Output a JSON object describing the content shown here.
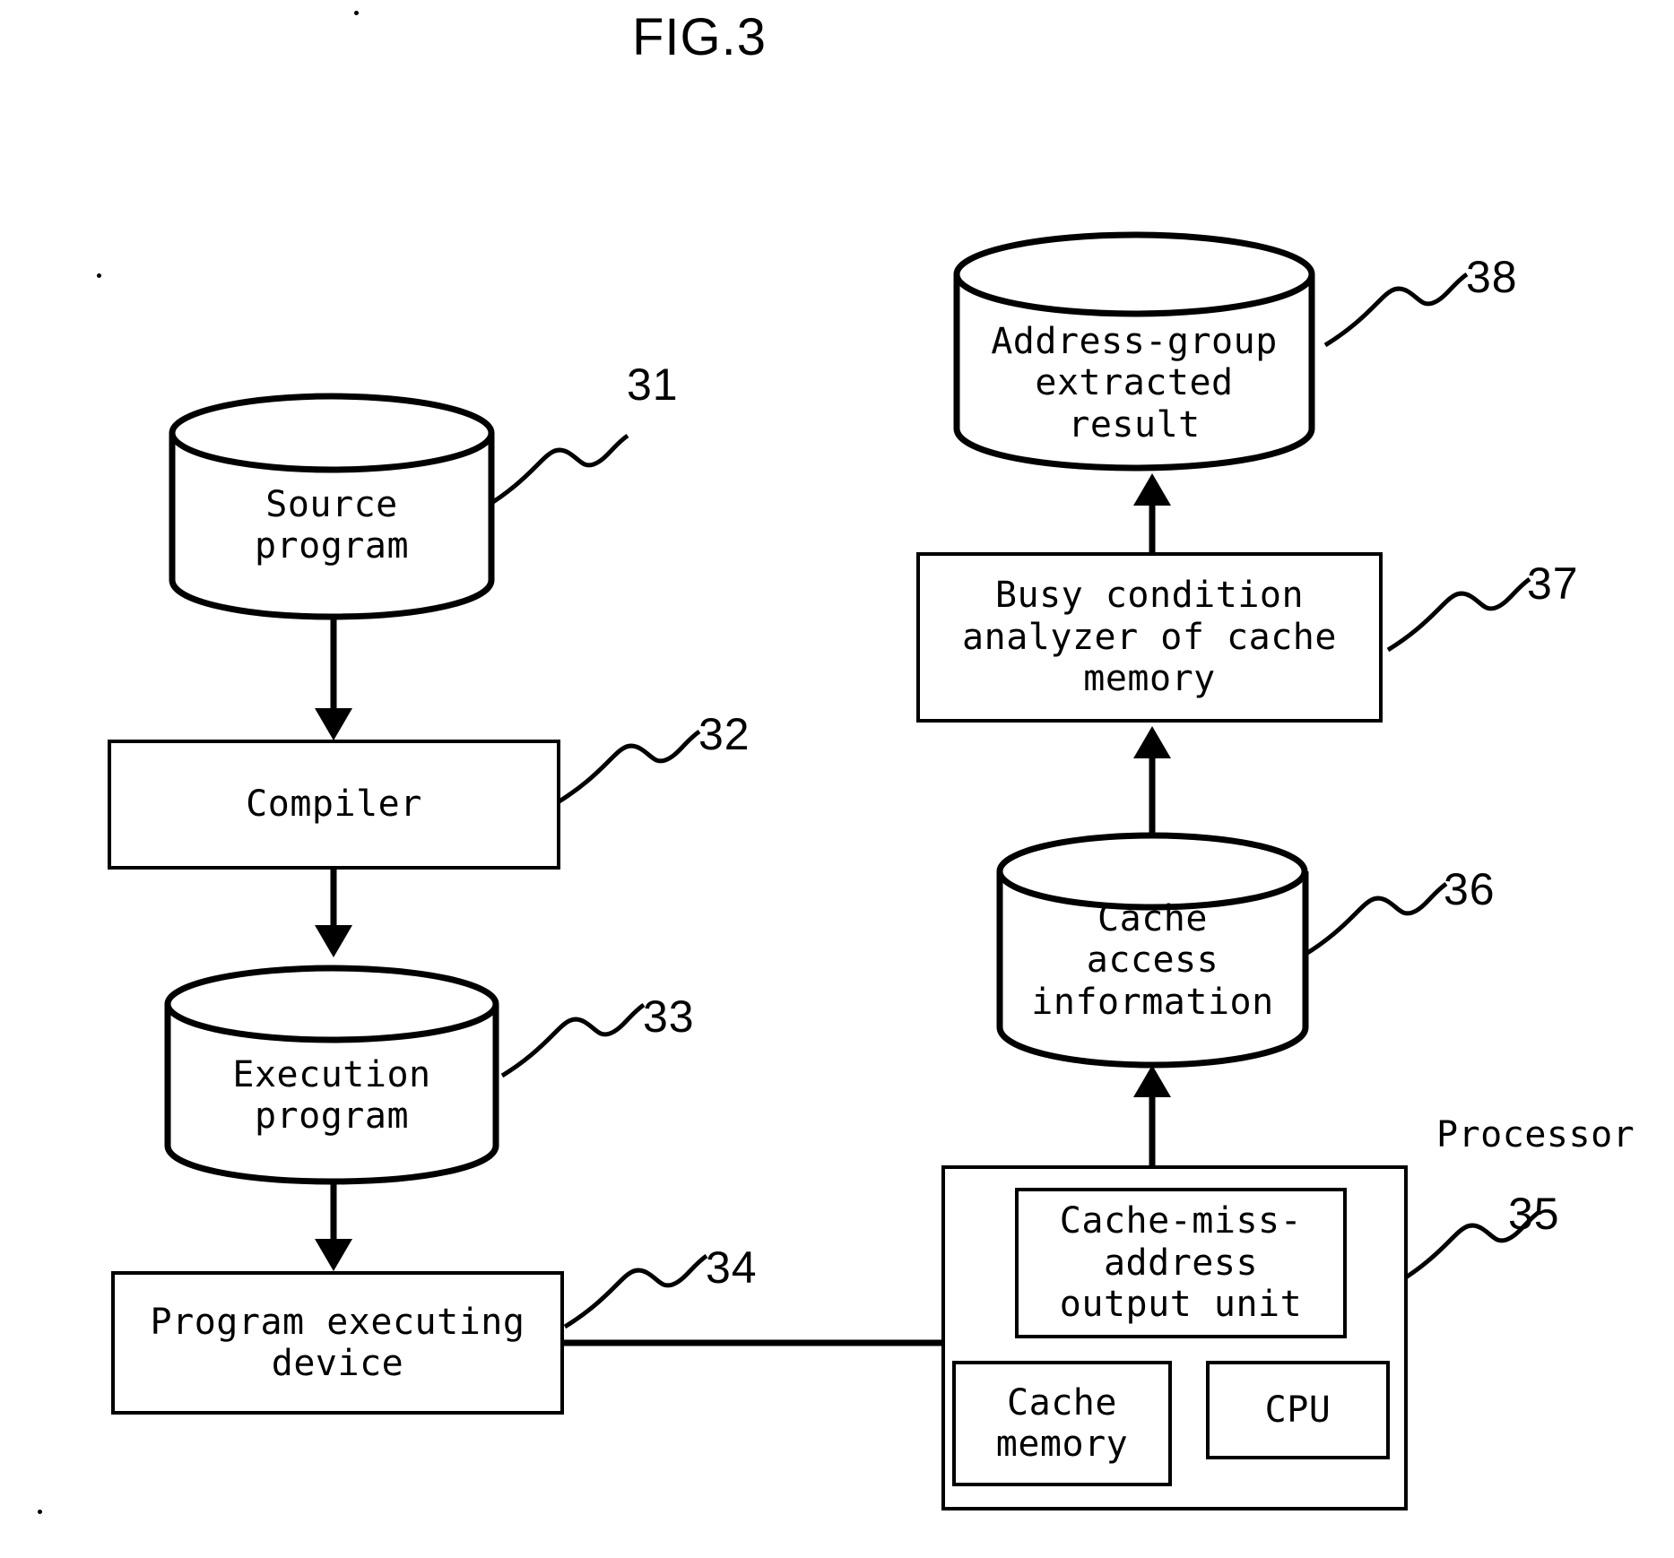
{
  "figure": {
    "title": "FIG.3",
    "kind": "patent-block-diagram"
  },
  "nodes": {
    "source_program": {
      "label": "Source\nprogram",
      "ref": "31",
      "shape": "cylinder"
    },
    "compiler": {
      "label": "Compiler",
      "ref": "32",
      "shape": "rectangle"
    },
    "execution_program": {
      "label": "Execution\nprogram",
      "ref": "33",
      "shape": "cylinder"
    },
    "program_executing_device": {
      "label": "Program executing\ndevice",
      "ref": "34",
      "shape": "rectangle"
    },
    "processor": {
      "label": "Processor",
      "ref": "35",
      "shape": "rectangle"
    },
    "cache_miss_address_output_unit": {
      "label": "Cache-miss-\naddress\noutput unit",
      "shape": "rectangle"
    },
    "cache_memory": {
      "label": "Cache\nmemory",
      "shape": "rectangle"
    },
    "cpu": {
      "label": "CPU",
      "shape": "rectangle"
    },
    "cache_access_information": {
      "label": "Cache\naccess\ninformation",
      "ref": "36",
      "shape": "cylinder"
    },
    "busy_condition_analyzer": {
      "label": "Busy condition\nanalyzer of cache\nmemory",
      "ref": "37",
      "shape": "rectangle"
    },
    "address_group_extracted_result": {
      "label": "Address-group\nextracted\nresult",
      "ref": "38",
      "shape": "cylinder"
    }
  },
  "connections": [
    {
      "from": "source_program",
      "to": "compiler",
      "style": "arrow-down"
    },
    {
      "from": "compiler",
      "to": "execution_program",
      "style": "arrow-down"
    },
    {
      "from": "execution_program",
      "to": "program_executing_device",
      "style": "arrow-down"
    },
    {
      "from": "program_executing_device",
      "to": "processor",
      "style": "line"
    },
    {
      "from": "processor",
      "to": "cache_access_information",
      "style": "arrow-up"
    },
    {
      "from": "cache_access_information",
      "to": "busy_condition_analyzer",
      "style": "arrow-up"
    },
    {
      "from": "busy_condition_analyzer",
      "to": "address_group_extracted_result",
      "style": "arrow-up"
    }
  ],
  "colors": {
    "ink": "#000000",
    "paper": "#ffffff"
  }
}
